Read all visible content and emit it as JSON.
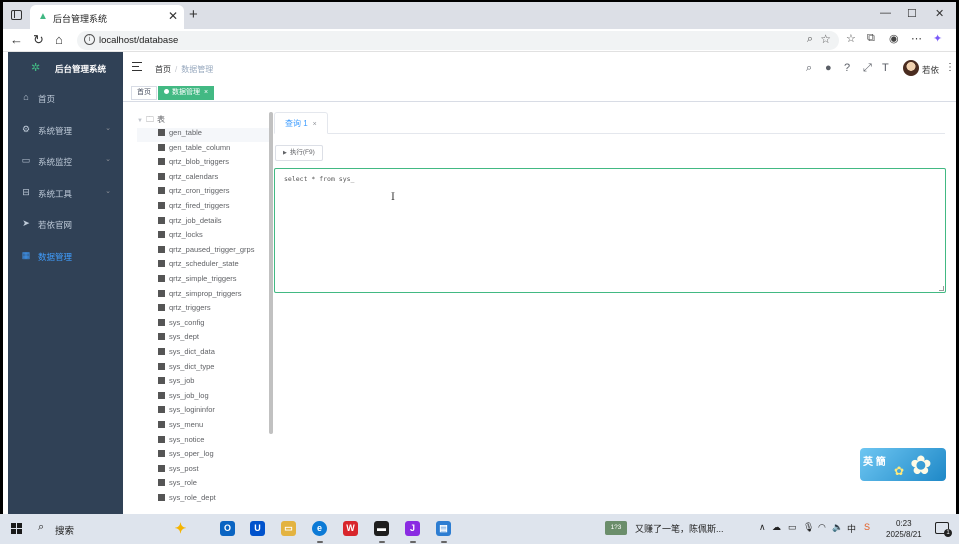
{
  "browser": {
    "tab_title": "后台管理系统",
    "tab_close": "✕",
    "new_tab": "+",
    "url": "localhost/database",
    "window_controls": [
      "—",
      "☐",
      "✕"
    ]
  },
  "app": {
    "logo_text": "后台管理系统",
    "menu": [
      {
        "label": "首页",
        "icon": "dashboard-icon",
        "glyph": "⌂",
        "has_arrow": false,
        "active": false
      },
      {
        "label": "系统管理",
        "icon": "system-icon",
        "glyph": "⚙",
        "has_arrow": true,
        "active": false
      },
      {
        "label": "系统监控",
        "icon": "monitor-icon",
        "glyph": "▭",
        "has_arrow": true,
        "active": false
      },
      {
        "label": "系统工具",
        "icon": "tool-icon",
        "glyph": "⊟",
        "has_arrow": true,
        "active": false
      },
      {
        "label": "若依官网",
        "icon": "guide-icon",
        "glyph": "➤",
        "has_arrow": false,
        "active": false
      },
      {
        "label": "数据管理",
        "icon": "table-icon",
        "glyph": "▦",
        "has_arrow": false,
        "active": true
      }
    ],
    "breadcrumb": [
      "首页",
      "数据管理"
    ],
    "breadcrumb_sep": "/",
    "user_name": "若依",
    "tags": [
      {
        "label": "首页",
        "active": false
      },
      {
        "label": "数据管理",
        "active": true,
        "close": "×"
      }
    ]
  },
  "tree": {
    "root_label": "表",
    "items": [
      "gen_table",
      "gen_table_column",
      "qrtz_blob_triggers",
      "qrtz_calendars",
      "qrtz_cron_triggers",
      "qrtz_fired_triggers",
      "qrtz_job_details",
      "qrtz_locks",
      "qrtz_paused_trigger_grps",
      "qrtz_scheduler_state",
      "qrtz_simple_triggers",
      "qrtz_simprop_triggers",
      "qrtz_triggers",
      "sys_config",
      "sys_dept",
      "sys_dict_data",
      "sys_dict_type",
      "sys_job",
      "sys_job_log",
      "sys_logininfor",
      "sys_menu",
      "sys_notice",
      "sys_oper_log",
      "sys_post",
      "sys_role",
      "sys_role_dept"
    ]
  },
  "query": {
    "tab_label": "查询 1",
    "tab_close": "×",
    "run_label": "执行(F9)",
    "sql": "select * from sys_",
    "cursor": "I"
  },
  "widget": {
    "label": "英 簡"
  },
  "taskbar": {
    "search_label": "搜索",
    "news_badge": "1?3",
    "news_text": "又赚了一笔，陈佩斯...",
    "time": "0:23",
    "date": "2025/8/21",
    "notif_count": "1"
  },
  "colors": {
    "sidebar_bg": "#304156",
    "accent": "#409eff",
    "tag_active": "#42b983"
  }
}
